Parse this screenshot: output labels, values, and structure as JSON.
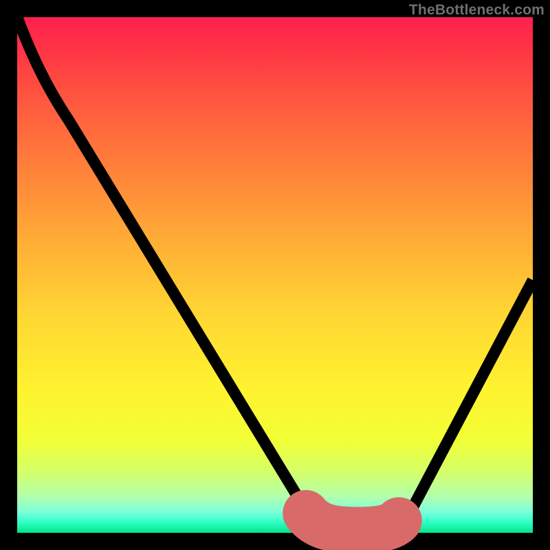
{
  "watermark": "TheBottleneck.com",
  "colors": {
    "frame_bg": "#000000",
    "curve": "#000000",
    "optimal_band": "#d86a6a",
    "gradient_top": "#ff1f4e",
    "gradient_bottom": "#00e589"
  },
  "chart_data": {
    "type": "line",
    "title": "",
    "xlabel": "",
    "ylabel": "",
    "xlim": [
      0,
      100
    ],
    "ylim": [
      0,
      100
    ],
    "x": [
      0,
      5,
      10,
      15,
      20,
      25,
      30,
      35,
      40,
      45,
      50,
      55,
      56,
      58,
      60,
      62,
      64,
      66,
      68,
      70,
      72,
      74,
      75,
      80,
      85,
      90,
      95,
      100
    ],
    "y": [
      100,
      93,
      84,
      75,
      66,
      57,
      48,
      39,
      30,
      21,
      13,
      6,
      5,
      3,
      2,
      1,
      0.5,
      0.5,
      0.5,
      0.5,
      1,
      2,
      3,
      9,
      18,
      28,
      38,
      49
    ],
    "optimal_band": {
      "x_start": 56,
      "x_end": 74,
      "y": 0.5,
      "dot_x": 74,
      "dot_y": 2
    },
    "notes": "Axes are unlabeled; values are estimated from the raster. y represents height from chart bottom as a percentage; x represents horizontal position as a percentage."
  }
}
